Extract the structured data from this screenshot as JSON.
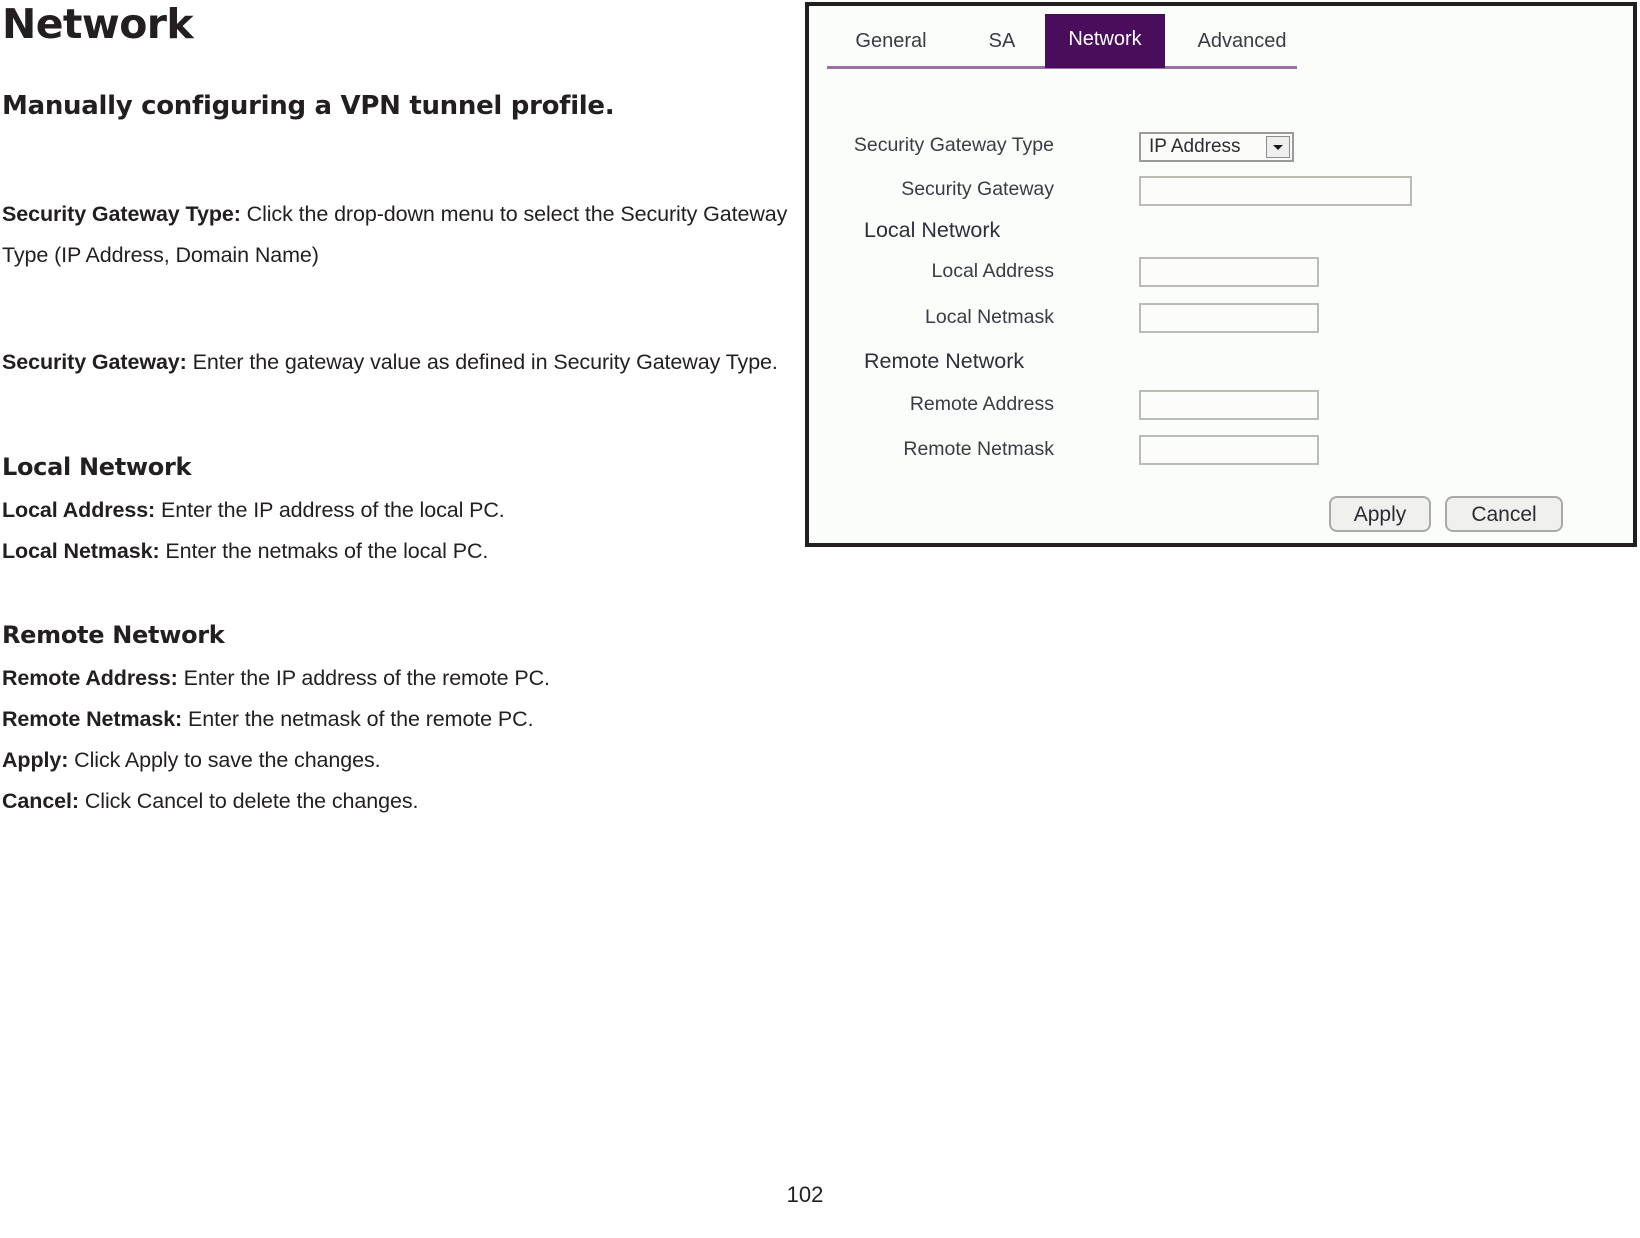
{
  "document": {
    "title": "Network",
    "subtitle": "Manually configuring a VPN tunnel profile.",
    "paragraphs": [
      {
        "label": "Security Gateway Type:",
        "text": " Click the drop-down menu to select the Security Gateway Type (IP Address, Domain Name)"
      },
      {
        "label": "Security Gateway:",
        "text": " Enter the gateway value as defined in Security Gateway Type."
      }
    ],
    "sections": [
      {
        "heading": "Local Network",
        "items": [
          {
            "label": "Local Address:",
            "text": " Enter the IP address of the local PC."
          },
          {
            "label": "Local Netmask:",
            "text": " Enter the netmaks of the local PC."
          }
        ]
      },
      {
        "heading": "Remote Network",
        "items": [
          {
            "label": "Remote Address:",
            "text": " Enter the IP address of the remote PC."
          },
          {
            "label": "Remote Netmask:",
            "text": " Enter the netmask of the remote PC."
          },
          {
            "label": "Apply:",
            "text": " Click Apply to save the changes."
          },
          {
            "label": "Cancel:",
            "text": " Click Cancel to delete the changes."
          }
        ]
      }
    ],
    "page_number": "102"
  },
  "screenshot": {
    "tabs": [
      {
        "label": "General",
        "active": false
      },
      {
        "label": "SA",
        "active": false
      },
      {
        "label": "Network",
        "active": true
      },
      {
        "label": "Advanced",
        "active": false
      }
    ],
    "active_tab_color": "#490d5c",
    "tab_rule_color": "#9a6fa4",
    "panel_background": "#fbfdfa",
    "fields": [
      {
        "label": "Security Gateway Type",
        "type": "select",
        "value": "IP Address"
      },
      {
        "label": "Security Gateway",
        "type": "text",
        "value": ""
      },
      {
        "label": "Local Network",
        "type": "group"
      },
      {
        "label": "Local Address",
        "type": "text",
        "value": ""
      },
      {
        "label": "Local Netmask",
        "type": "text",
        "value": ""
      },
      {
        "label": "Remote Network",
        "type": "group"
      },
      {
        "label": "Remote Address",
        "type": "text",
        "value": ""
      },
      {
        "label": "Remote Netmask",
        "type": "text",
        "value": ""
      }
    ],
    "buttons": {
      "apply": "Apply",
      "cancel": "Cancel"
    },
    "dropdown_icon": "chevron-down-icon"
  }
}
